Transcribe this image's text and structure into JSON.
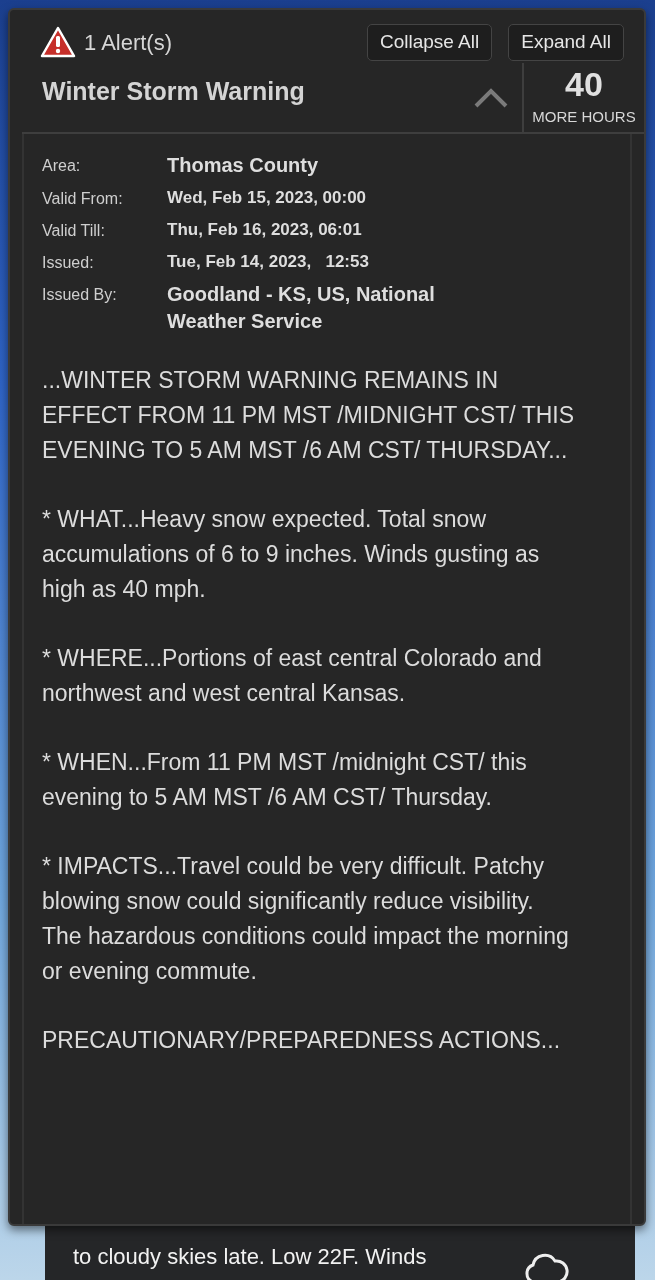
{
  "header": {
    "alert_count": "1 Alert(s)",
    "buttons": [
      "Collapse All",
      "Expand All"
    ]
  },
  "alert": {
    "title": "Winter Storm Warning",
    "expanded": true,
    "hours": "40",
    "hours_label": "MORE HOURS",
    "details": [
      {
        "label": "Area:",
        "value": "Thomas County",
        "kind": "large"
      },
      {
        "label": "Valid From:",
        "value": "Wed, Feb 15, 2023, 00:00",
        "kind": "normal"
      },
      {
        "label": "Valid Till:",
        "value": "Thu, Feb 16, 2023, 06:01",
        "kind": "normal"
      },
      {
        "label": "Issued:",
        "value": "Tue, Feb 14, 2023,   12:53",
        "kind": "normal"
      },
      {
        "label": "Issued By:",
        "value": "Goodland - KS, US, National Weather Service",
        "kind": "large"
      }
    ],
    "paragraphs": [
      "...WINTER STORM WARNING REMAINS IN EFFECT FROM 11 PM MST /MIDNIGHT CST/ THIS EVENING TO 5 AM MST /6 AM CST/ THURSDAY...",
      "* WHAT...Heavy snow expected. Total snow accumulations of 6 to 9 inches. Winds gusting as high as 40 mph.",
      "* WHERE...Portions of east central Colorado and northwest and west central Kansas.",
      "* WHEN...From 11 PM MST /midnight CST/ this evening to 5 AM MST /6 AM CST/ Thursday.",
      "* IMPACTS...Travel could be very difficult. Patchy blowing snow could significantly reduce visibility. The hazardous conditions could impact the morning or evening commute.",
      "PRECAUTIONARY/PREPAREDNESS ACTIONS..."
    ]
  },
  "forecast_card": {
    "text": "to cloudy skies late. Low 22F. Winds"
  }
}
